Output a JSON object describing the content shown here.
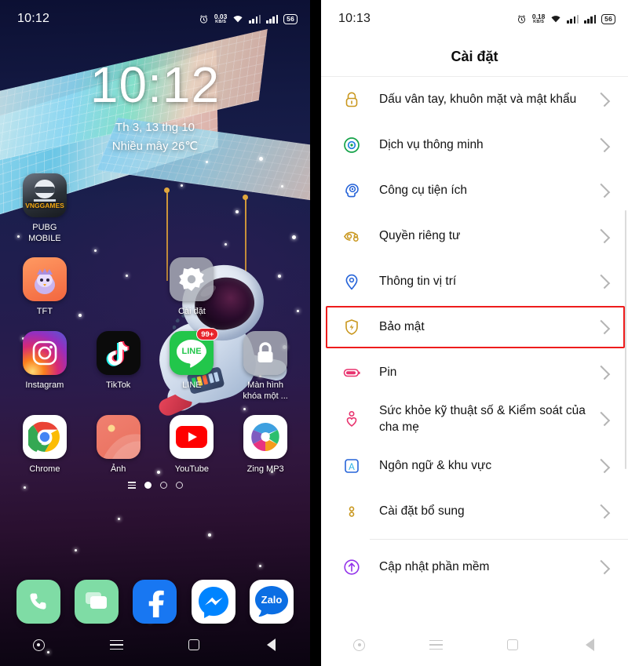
{
  "left_phone": {
    "status_bar": {
      "time": "10:12",
      "net_rate": "0.03",
      "net_unit": "KB/S",
      "battery": "56",
      "icons": [
        "alarm-icon",
        "network-rate",
        "wifi-icon",
        "signal-bars-1",
        "signal-bars-2",
        "battery-icon"
      ]
    },
    "clock_widget": {
      "time": "10:12",
      "date": "Th 3, 13 thg 10",
      "weather": "Nhiều mây 26℃"
    },
    "app_rows": [
      [
        {
          "label": "PUBG\nMOBILE",
          "icon": "pubg-mobile-icon",
          "badge": null
        },
        {
          "label": "",
          "icon": "empty",
          "badge": null
        },
        {
          "label": "",
          "icon": "empty",
          "badge": null
        },
        {
          "label": "",
          "icon": "empty",
          "badge": null
        }
      ],
      [
        {
          "label": "TFT",
          "icon": "tft-icon",
          "badge": null
        },
        {
          "label": "",
          "icon": "empty",
          "badge": null
        },
        {
          "label": "Cài đặt",
          "icon": "settings-gear-icon",
          "badge": null
        },
        {
          "label": "",
          "icon": "empty",
          "badge": null
        }
      ],
      [
        {
          "label": "Instagram",
          "icon": "instagram-icon",
          "badge": null
        },
        {
          "label": "TikTok",
          "icon": "tiktok-icon",
          "badge": null
        },
        {
          "label": "LINE",
          "icon": "line-icon",
          "badge": "99+"
        },
        {
          "label": "Màn hình\nkhóa một ...",
          "icon": "lock-screen-icon",
          "badge": null
        }
      ],
      [
        {
          "label": "Chrome",
          "icon": "chrome-icon",
          "badge": null
        },
        {
          "label": "Ảnh",
          "icon": "photos-icon",
          "badge": null
        },
        {
          "label": "YouTube",
          "icon": "youtube-icon",
          "badge": null
        },
        {
          "label": "Zing MP3",
          "icon": "zing-mp3-icon",
          "badge": null
        }
      ]
    ],
    "page_indicator": {
      "pages": 3,
      "active": 0,
      "menu_icon": "apps-menu-icon"
    },
    "dock": [
      {
        "label": "Phone",
        "icon": "phone-icon"
      },
      {
        "label": "Messages",
        "icon": "messages-icon"
      },
      {
        "label": "Facebook",
        "icon": "facebook-icon"
      },
      {
        "label": "Messenger",
        "icon": "messenger-icon"
      },
      {
        "label": "Zalo",
        "icon": "zalo-icon"
      }
    ],
    "nav_bar": [
      "assistant-icon",
      "recents-icon",
      "home-icon",
      "back-icon"
    ]
  },
  "right_phone": {
    "status_bar": {
      "time": "10:13",
      "net_rate": "0.18",
      "net_unit": "KB/S",
      "battery": "56"
    },
    "header": {
      "title": "Cài đặt"
    },
    "settings_items": [
      {
        "label": "Dấu vân tay, khuôn mặt và mật khẩu",
        "icon": "lock-icon",
        "color": "#c9971e",
        "highlighted": false
      },
      {
        "label": "Dịch vụ thông minh",
        "icon": "smart-services-icon",
        "color": "#16a34a",
        "highlighted": false
      },
      {
        "label": "Công cụ tiện ích",
        "icon": "utility-tools-icon",
        "color": "#2563d8",
        "highlighted": false
      },
      {
        "label": "Quyền riêng tư",
        "icon": "privacy-eye-icon",
        "color": "#c9971e",
        "highlighted": false
      },
      {
        "label": "Thông tin vị trí",
        "icon": "location-pin-icon",
        "color": "#2563d8",
        "highlighted": false
      },
      {
        "label": "Bảo mật",
        "icon": "security-shield-icon",
        "color": "#c9971e",
        "highlighted": true
      },
      {
        "label": "Pin",
        "icon": "battery-icon",
        "color": "#e8336e",
        "highlighted": false
      },
      {
        "label": "Sức khỏe kỹ thuật số & Kiểm soát của cha mẹ",
        "icon": "digital-wellbeing-icon",
        "color": "#e8336e",
        "highlighted": false
      },
      {
        "label": "Ngôn ngữ & khu vực",
        "icon": "language-icon",
        "color": "#2563d8",
        "highlighted": false
      },
      {
        "label": "Cài đặt bổ sung",
        "icon": "additional-settings-icon",
        "color": "#c9971e",
        "highlighted": false
      },
      {
        "label": "Cập nhật phần mềm",
        "icon": "software-update-icon",
        "color": "#9333ea",
        "highlighted": false
      }
    ],
    "divider_before_index": 10,
    "nav_bar": [
      "assistant-icon",
      "recents-icon",
      "home-icon",
      "back-icon"
    ],
    "highlight_color": "#ee1c1c"
  }
}
